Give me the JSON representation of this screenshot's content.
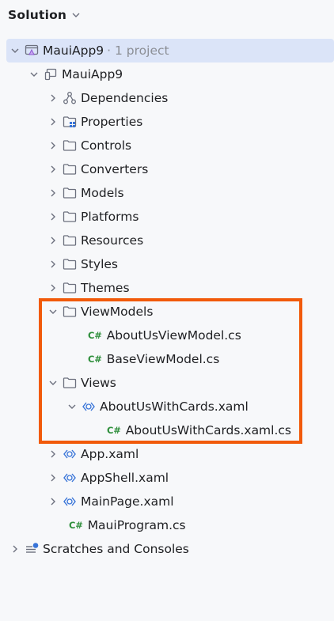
{
  "header": {
    "title": "Solution",
    "chevron_icon": "chevron-down-icon"
  },
  "tree": {
    "solution": {
      "label": "MauiApp9",
      "meta": "· 1 project"
    },
    "project": {
      "label": "MauiApp9"
    },
    "dependencies": "Dependencies",
    "properties": "Properties",
    "folders": [
      "Controls",
      "Converters",
      "Models",
      "Platforms",
      "Resources",
      "Styles",
      "Themes"
    ],
    "viewmodels": {
      "label": "ViewModels",
      "files": [
        "AboutUsViewModel.cs",
        "BaseViewModel.cs"
      ]
    },
    "views": {
      "label": "Views",
      "xaml": "AboutUsWithCards.xaml",
      "codebehind": "AboutUsWithCards.xaml.cs"
    },
    "xaml_files": [
      "App.xaml",
      "AppShell.xaml",
      "MainPage.xaml"
    ],
    "mauiprogram": "MauiProgram.cs",
    "scratches": "Scratches and Consoles",
    "cs_badge": "C#"
  },
  "colors": {
    "selection": "#dbe4f8",
    "highlight_border": "#f15a0a",
    "csharp_green": "#2f8f3c",
    "xaml_blue": "#3874d8"
  }
}
